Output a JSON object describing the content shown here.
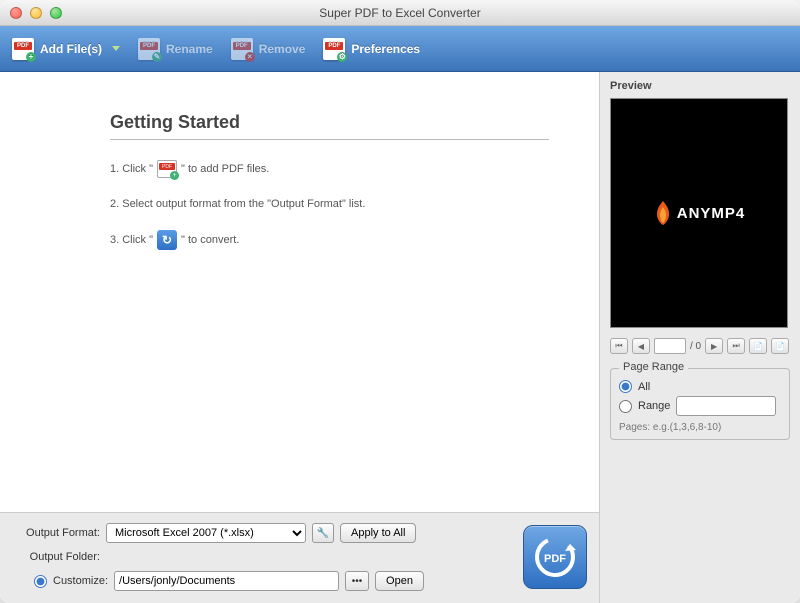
{
  "titlebar": {
    "title": "Super PDF to Excel Converter"
  },
  "toolbar": {
    "add_files": "Add File(s)",
    "rename": "Rename",
    "remove": "Remove",
    "preferences": "Preferences"
  },
  "getting_started": {
    "heading": "Getting Started",
    "step1_a": "1. Click \"",
    "step1_b": "\" to add PDF files.",
    "step2": "2. Select output format from the \"Output Format\" list.",
    "step3_a": "3. Click \"",
    "step3_b": "\" to convert."
  },
  "output": {
    "format_label": "Output Format:",
    "format_value": "Microsoft Excel 2007 (*.xlsx)",
    "apply_all": "Apply to All",
    "folder_label": "Output Folder:",
    "customize_label": "Customize:",
    "path_value": "/Users/jonly/Documents",
    "open_label": "Open"
  },
  "convert": {
    "label": "PDF"
  },
  "preview": {
    "title": "Preview",
    "logo_text": "ANYMP4",
    "page_total": "/ 0"
  },
  "page_range": {
    "legend": "Page Range",
    "all": "All",
    "range": "Range",
    "hint": "Pages: e.g.(1,3,6,8-10)"
  }
}
